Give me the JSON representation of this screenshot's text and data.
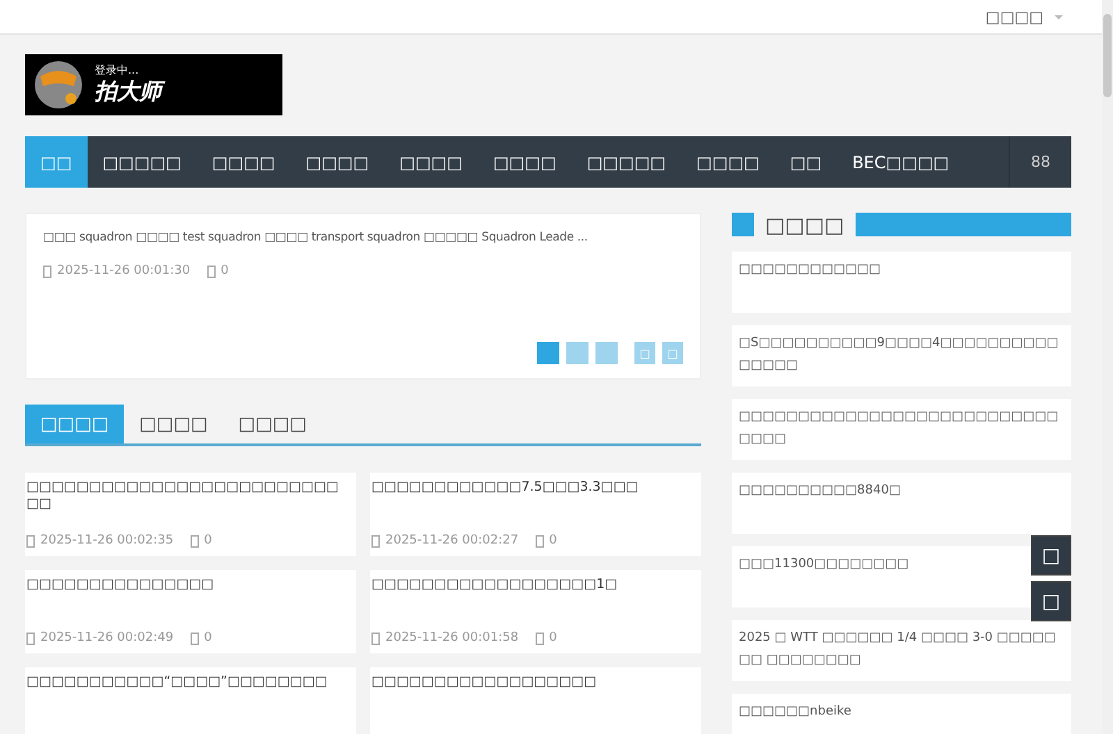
{
  "top_bar": {
    "menu_label": "□□□□"
  },
  "logo": {
    "status": "登录中...",
    "name": "拍大师"
  },
  "nav": {
    "items": [
      {
        "label": "□□",
        "selected": true
      },
      {
        "label": "□□□□□",
        "selected": false
      },
      {
        "label": "□□□□",
        "selected": false
      },
      {
        "label": "□□□□",
        "selected": false
      },
      {
        "label": "□□□□",
        "selected": false
      },
      {
        "label": "□□□□",
        "selected": false
      },
      {
        "label": "□□□□□",
        "selected": false
      },
      {
        "label": "□□□□",
        "selected": false
      },
      {
        "label": "□□",
        "selected": false
      },
      {
        "label": "BEC□□□□",
        "selected": false
      }
    ],
    "more": "88"
  },
  "slider": {
    "title": "□□□  squadron □□□□  test squadron □□□□ transport squadron □□□□□ Squadron Leade ...",
    "date": "2025-11-26 00:01:30",
    "comments": "0",
    "dots": [
      {
        "selected": true
      },
      {
        "selected": false
      },
      {
        "selected": false
      }
    ],
    "prev": "□",
    "next": "□"
  },
  "tabs": [
    {
      "label": "□□□□",
      "selected": true
    },
    {
      "label": "□□□□",
      "selected": false
    },
    {
      "label": "□□□□",
      "selected": false
    }
  ],
  "articles": [
    {
      "title": "□□□□□□□□□□□□□□□□□□□□□□□□□□□",
      "date": "2025-11-26 00:02:35",
      "comments": "0"
    },
    {
      "title": "□□□□□□□□□□□□7.5□□□3.3□□□",
      "date": "2025-11-26 00:02:27",
      "comments": "0"
    },
    {
      "title": "□□□□□□□□□□□□□□□",
      "date": "2025-11-26 00:02:49",
      "comments": "0"
    },
    {
      "title": "□□□□□□□□□□□□□□□□□□1□",
      "date": "2025-11-26 00:01:58",
      "comments": "0"
    },
    {
      "title": "□□□□□□□□□□□“□□□□”□□□□□□□□"
    },
    {
      "title": "□□□□□□□□□□□□□□□□□□"
    }
  ],
  "sidebar": {
    "title": "□□□□",
    "items": [
      "□□□□□□□□□□□□",
      "□S□□□□□□□□□□9□□□□4□□□□□□□□□□□□□□□",
      "□□□□□□□□□□□□□□□□□□□□□□□□□□□□□□□",
      "□□□□□□□□□□8840□",
      "□□□11300□□□□□□□□",
      "2025 □ WTT □□□□□□ 1/4 □□□□ 3-0 □□□□□□□ □□□□□□□□",
      "□□□□□□nbeike"
    ]
  },
  "float_buttons": [
    "□",
    "□"
  ]
}
